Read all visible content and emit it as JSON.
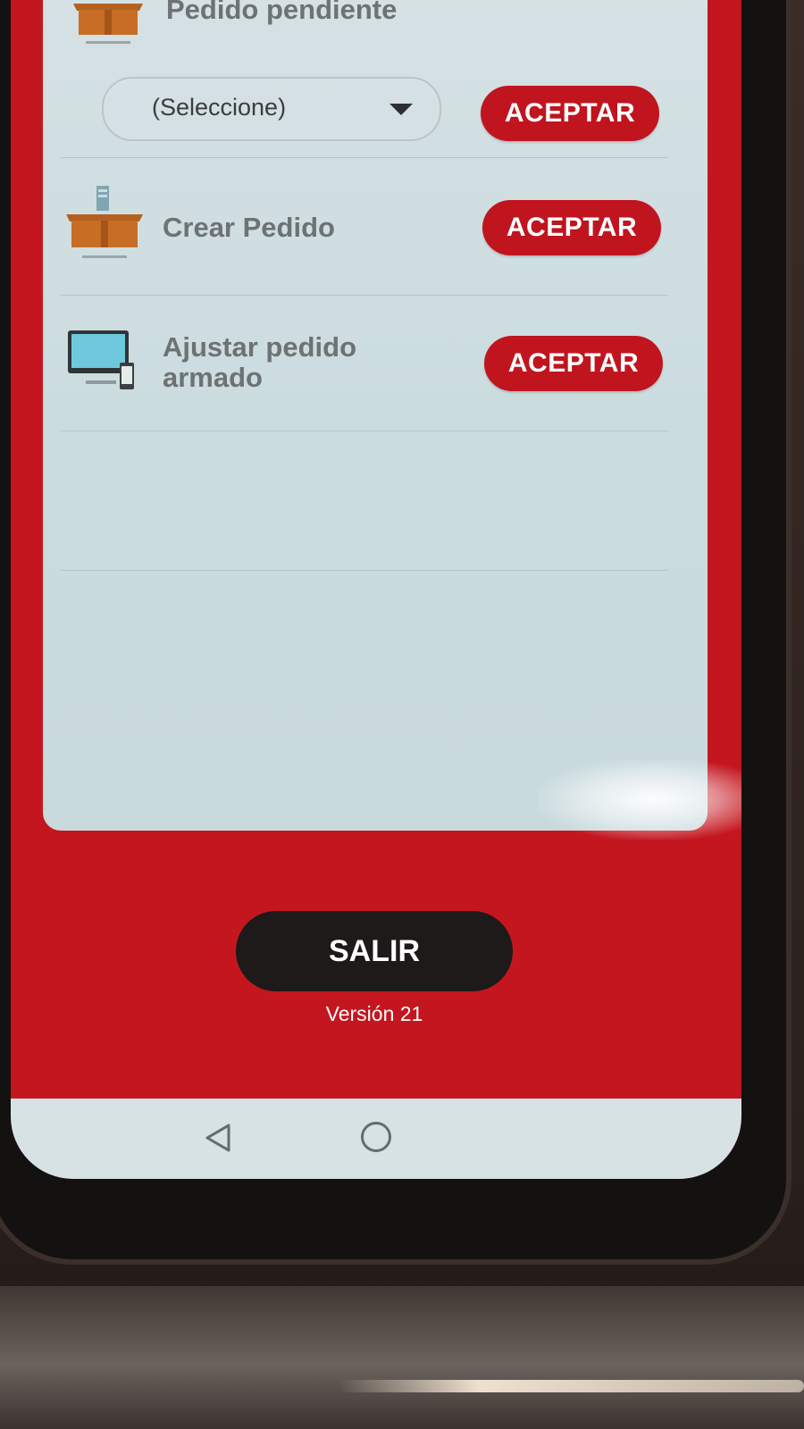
{
  "rows": [
    {
      "label_lines": [
        "Pedido pendiente"
      ],
      "icon": "pending-box-icon",
      "select": {
        "value": "(Seleccione)"
      },
      "button": "ACEPTAR"
    },
    {
      "label_lines": [
        "Crear Pedido"
      ],
      "icon": "create-box-icon",
      "button": "ACEPTAR"
    },
    {
      "label_lines": [
        "Ajustar pedido",
        "armado"
      ],
      "icon": "computer-icon",
      "button": "ACEPTAR"
    }
  ],
  "footer": {
    "exit_label": "SALIR",
    "version": "Versión 21"
  },
  "navbar": {
    "back": "back-icon",
    "home": "home-icon"
  },
  "colors": {
    "brand_red": "#c4161f",
    "card_bg": "#d6e1e4",
    "button_red": "#c0151f",
    "exit_bg": "#1d1a19"
  }
}
